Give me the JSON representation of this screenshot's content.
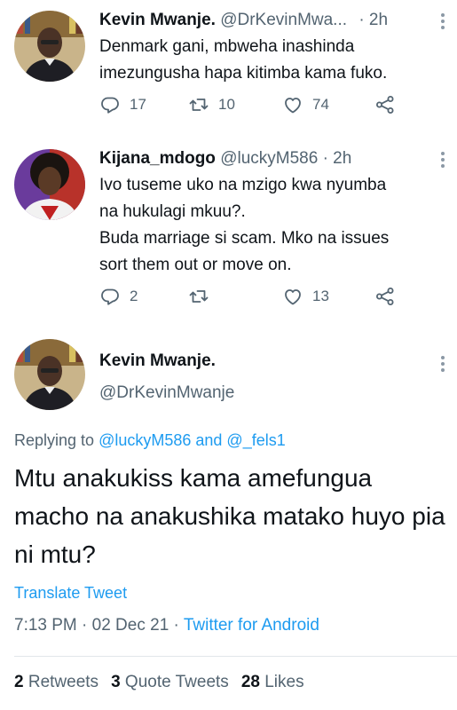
{
  "tweets": [
    {
      "name": "Kevin Mwanje.",
      "handle": "@DrKevinMwa...",
      "time": "· 2h",
      "text": "Denmark gani, mbweha inashinda imezungusha hapa kitimba kama fuko.",
      "replies": "17",
      "retweets": "10",
      "likes": "74"
    },
    {
      "name": "Kijana_mdogo",
      "handle": "@luckyM586 · 2h",
      "text_lines": [
        "Ivo tuseme uko na mzigo kwa nyumba",
        "na hukulagi mkuu?.",
        "Buda marriage si scam. Mko na issues",
        "sort them out or move on."
      ],
      "replies": "2",
      "retweets": "",
      "likes": "13"
    }
  ],
  "main_tweet": {
    "name": "Kevin Mwanje.",
    "handle": "@DrKevinMwanje",
    "replying_prefix": "Replying to ",
    "replying_user1": "@luckyM586",
    "replying_and": " and ",
    "replying_user2": "@_fels1",
    "text": "Mtu anakukiss kama amefungua macho na anakushika matako huyo pia ni mtu?",
    "translate": "Translate Tweet",
    "time": "7:13 PM · 02 Dec 21 · ",
    "source": "Twitter for Android",
    "retweets_count": "2",
    "retweets_label": "Retweets",
    "quotes_count": "3",
    "quotes_label": "Quote Tweets",
    "likes_count": "28",
    "likes_label": "Likes"
  },
  "icons": {
    "reply": "reply-icon",
    "retweet": "retweet-icon",
    "like": "heart-icon",
    "share": "share-icon",
    "more": "more-icon"
  },
  "colors": {
    "link": "#1d9bf0",
    "muted": "#536471",
    "text": "#0f1419"
  }
}
